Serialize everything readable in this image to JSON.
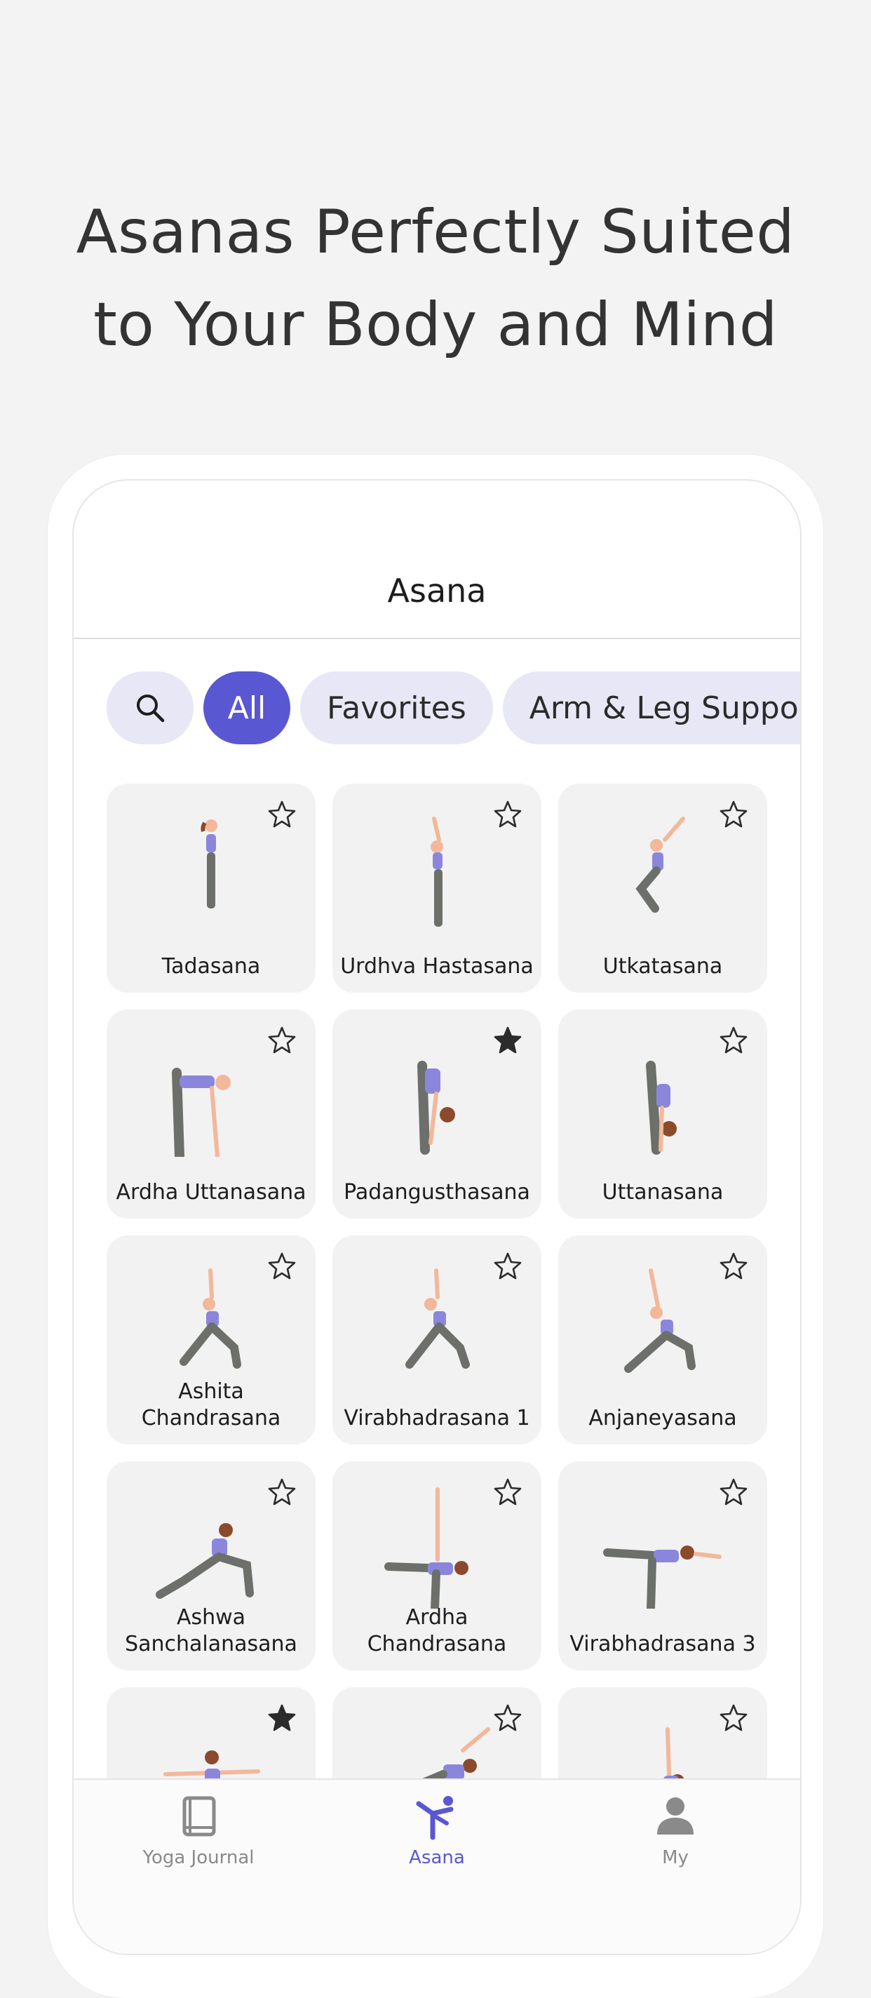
{
  "headline": {
    "line1": "Asanas Perfectly Suited",
    "line2": "to Your Body and Mind"
  },
  "screen": {
    "title": "Asana"
  },
  "filters": {
    "search_icon": "search-icon",
    "chips": [
      "All",
      "Favorites",
      "Arm & Leg Support"
    ],
    "selected": "All"
  },
  "poses": [
    {
      "name": "Tadasana",
      "favorite": false
    },
    {
      "name": "Urdhva Hastasana",
      "favorite": false
    },
    {
      "name": "Utkatasana",
      "favorite": false
    },
    {
      "name": "Ardha Uttanasana",
      "favorite": false
    },
    {
      "name": "Padangusthasana",
      "favorite": true
    },
    {
      "name": "Uttanasana",
      "favorite": false
    },
    {
      "name": "Ashita Chandrasana",
      "favorite": false
    },
    {
      "name": "Virabhadrasana 1",
      "favorite": false
    },
    {
      "name": "Anjaneyasana",
      "favorite": false
    },
    {
      "name": "Ashwa Sanchalanasana",
      "favorite": false
    },
    {
      "name": "Ardha Chandrasana",
      "favorite": false
    },
    {
      "name": "Virabhadrasana 3",
      "favorite": false
    },
    {
      "name": "",
      "favorite": true
    },
    {
      "name": "",
      "favorite": false
    },
    {
      "name": "",
      "favorite": false
    }
  ],
  "tabbar": {
    "items": [
      {
        "label": "Yoga Journal",
        "icon": "book-icon"
      },
      {
        "label": "Asana",
        "icon": "yoga-pose-icon"
      },
      {
        "label": "My",
        "icon": "user-icon"
      }
    ],
    "active": "Asana"
  },
  "colors": {
    "accent": "#5a57d3",
    "chip_bg": "#e8e7f6",
    "card_bg": "#f2f2f2",
    "background": "#f3f3f3"
  }
}
